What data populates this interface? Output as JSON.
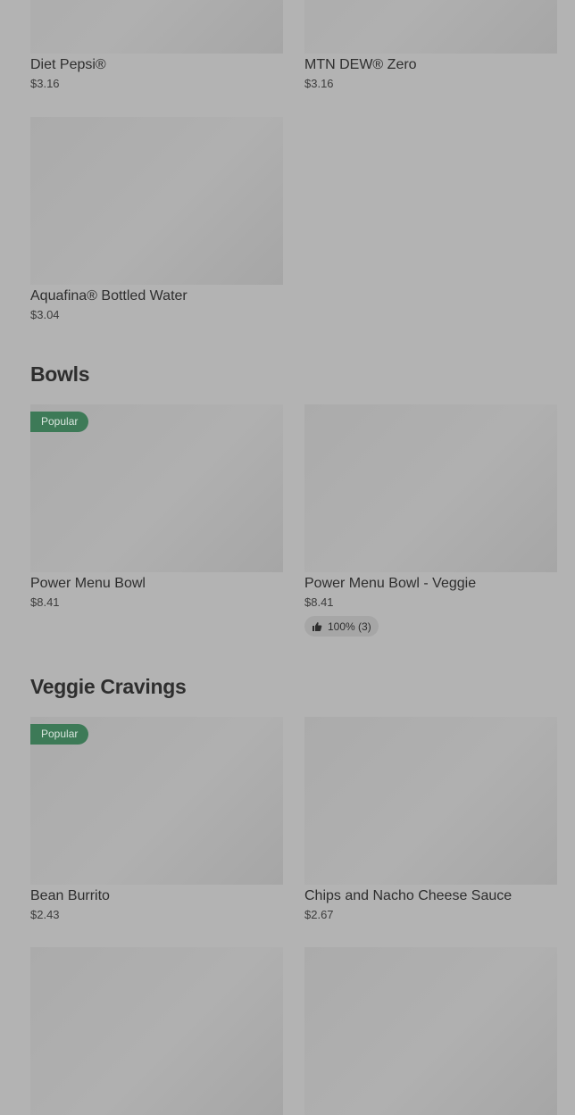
{
  "sections": {
    "drinks": {
      "items": [
        {
          "name": "Diet Pepsi®",
          "price": "$3.16"
        },
        {
          "name": "MTN DEW® Zero",
          "price": "$3.16"
        },
        {
          "name": "Aquafina® Bottled Water",
          "price": "$3.04"
        }
      ]
    },
    "bowls": {
      "title": "Bowls",
      "items": [
        {
          "name": "Power Menu Bowl",
          "price": "$8.41",
          "badge": "Popular"
        },
        {
          "name": "Power Menu Bowl - Veggie",
          "price": "$8.41",
          "rating": "100% (3)"
        }
      ]
    },
    "veggie": {
      "title": "Veggie Cravings",
      "items": [
        {
          "name": "Bean Burrito",
          "price": "$2.43",
          "badge": "Popular"
        },
        {
          "name": "Chips and Nacho Cheese Sauce",
          "price": "$2.67"
        }
      ]
    }
  },
  "colors": {
    "background": "#b3b3b3",
    "badge_bg": "#3d7a57",
    "rating_bg": "#a6a6a6"
  },
  "icons": {
    "rating": "thumbs-up-icon"
  }
}
